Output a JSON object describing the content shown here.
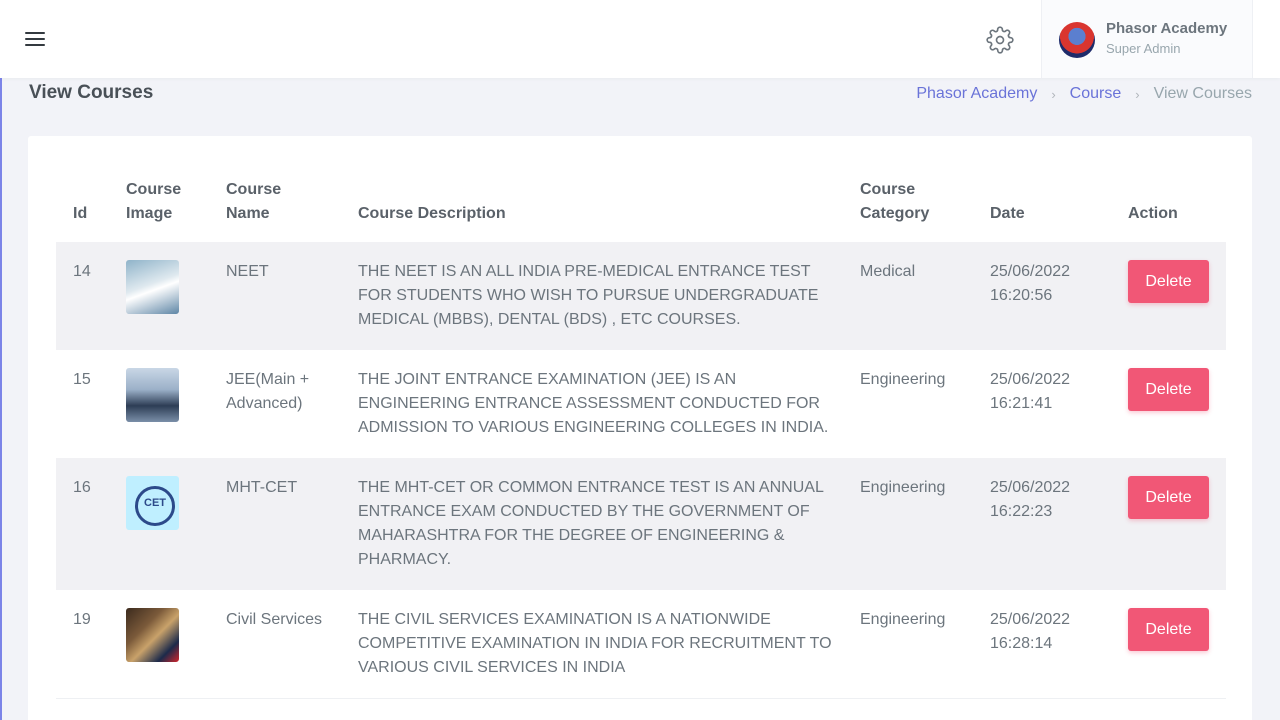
{
  "header": {
    "menu_icon": "hamburger-menu-icon",
    "settings_icon": "gear-icon",
    "profile": {
      "name": "Phasor Academy",
      "role": "Super Admin"
    }
  },
  "page": {
    "title": "View Courses",
    "breadcrumb": [
      "Phasor Academy",
      "Course",
      "View Courses"
    ]
  },
  "table": {
    "headers": {
      "id": "Id",
      "image": "Course Image",
      "name": "Course Name",
      "description": "Course Description",
      "category": "Course Category",
      "date": "Date",
      "action": "Action"
    },
    "rows": [
      {
        "id": "14",
        "image_icon": "course-thumbnail-neet",
        "name": "NEET",
        "description": "THE NEET IS AN ALL INDIA PRE-MEDICAL ENTRANCE TEST FOR STUDENTS WHO WISH TO PURSUE UNDERGRADUATE MEDICAL (MBBS), DENTAL (BDS) , ETC COURSES.",
        "category": "Medical",
        "date": "25/06/2022",
        "time": "16:20:56",
        "action_label": "Delete"
      },
      {
        "id": "15",
        "image_icon": "course-thumbnail-jee",
        "name": "JEE(Main + Advanced)",
        "description": "THE JOINT ENTRANCE EXAMINATION (JEE) IS AN ENGINEERING ENTRANCE ASSESSMENT CONDUCTED FOR ADMISSION TO VARIOUS ENGINEERING COLLEGES IN INDIA.",
        "category": "Engineering",
        "date": "25/06/2022",
        "time": "16:21:41",
        "action_label": "Delete"
      },
      {
        "id": "16",
        "image_icon": "course-thumbnail-mhtcet",
        "name": "MHT-CET",
        "description": "THE MHT-CET OR COMMON ENTRANCE TEST IS AN ANNUAL ENTRANCE EXAM CONDUCTED BY THE GOVERNMENT OF MAHARASHTRA FOR THE DEGREE OF ENGINEERING & PHARMACY.",
        "category": "Engineering",
        "date": "25/06/2022",
        "time": "16:22:23",
        "action_label": "Delete"
      },
      {
        "id": "19",
        "image_icon": "course-thumbnail-civil-services",
        "name": "Civil Services",
        "description": "THE CIVIL SERVICES EXAMINATION IS A NATIONWIDE COMPETITIVE EXAMINATION IN INDIA FOR RECRUITMENT TO VARIOUS CIVIL SERVICES IN INDIA",
        "category": "Engineering",
        "date": "25/06/2022",
        "time": "16:28:14",
        "action_label": "Delete"
      }
    ]
  },
  "colors": {
    "accent": "#6a73d8",
    "delete_button": "#f15776",
    "stripe": "#f1f1f4",
    "background": "#f2f3f8"
  }
}
